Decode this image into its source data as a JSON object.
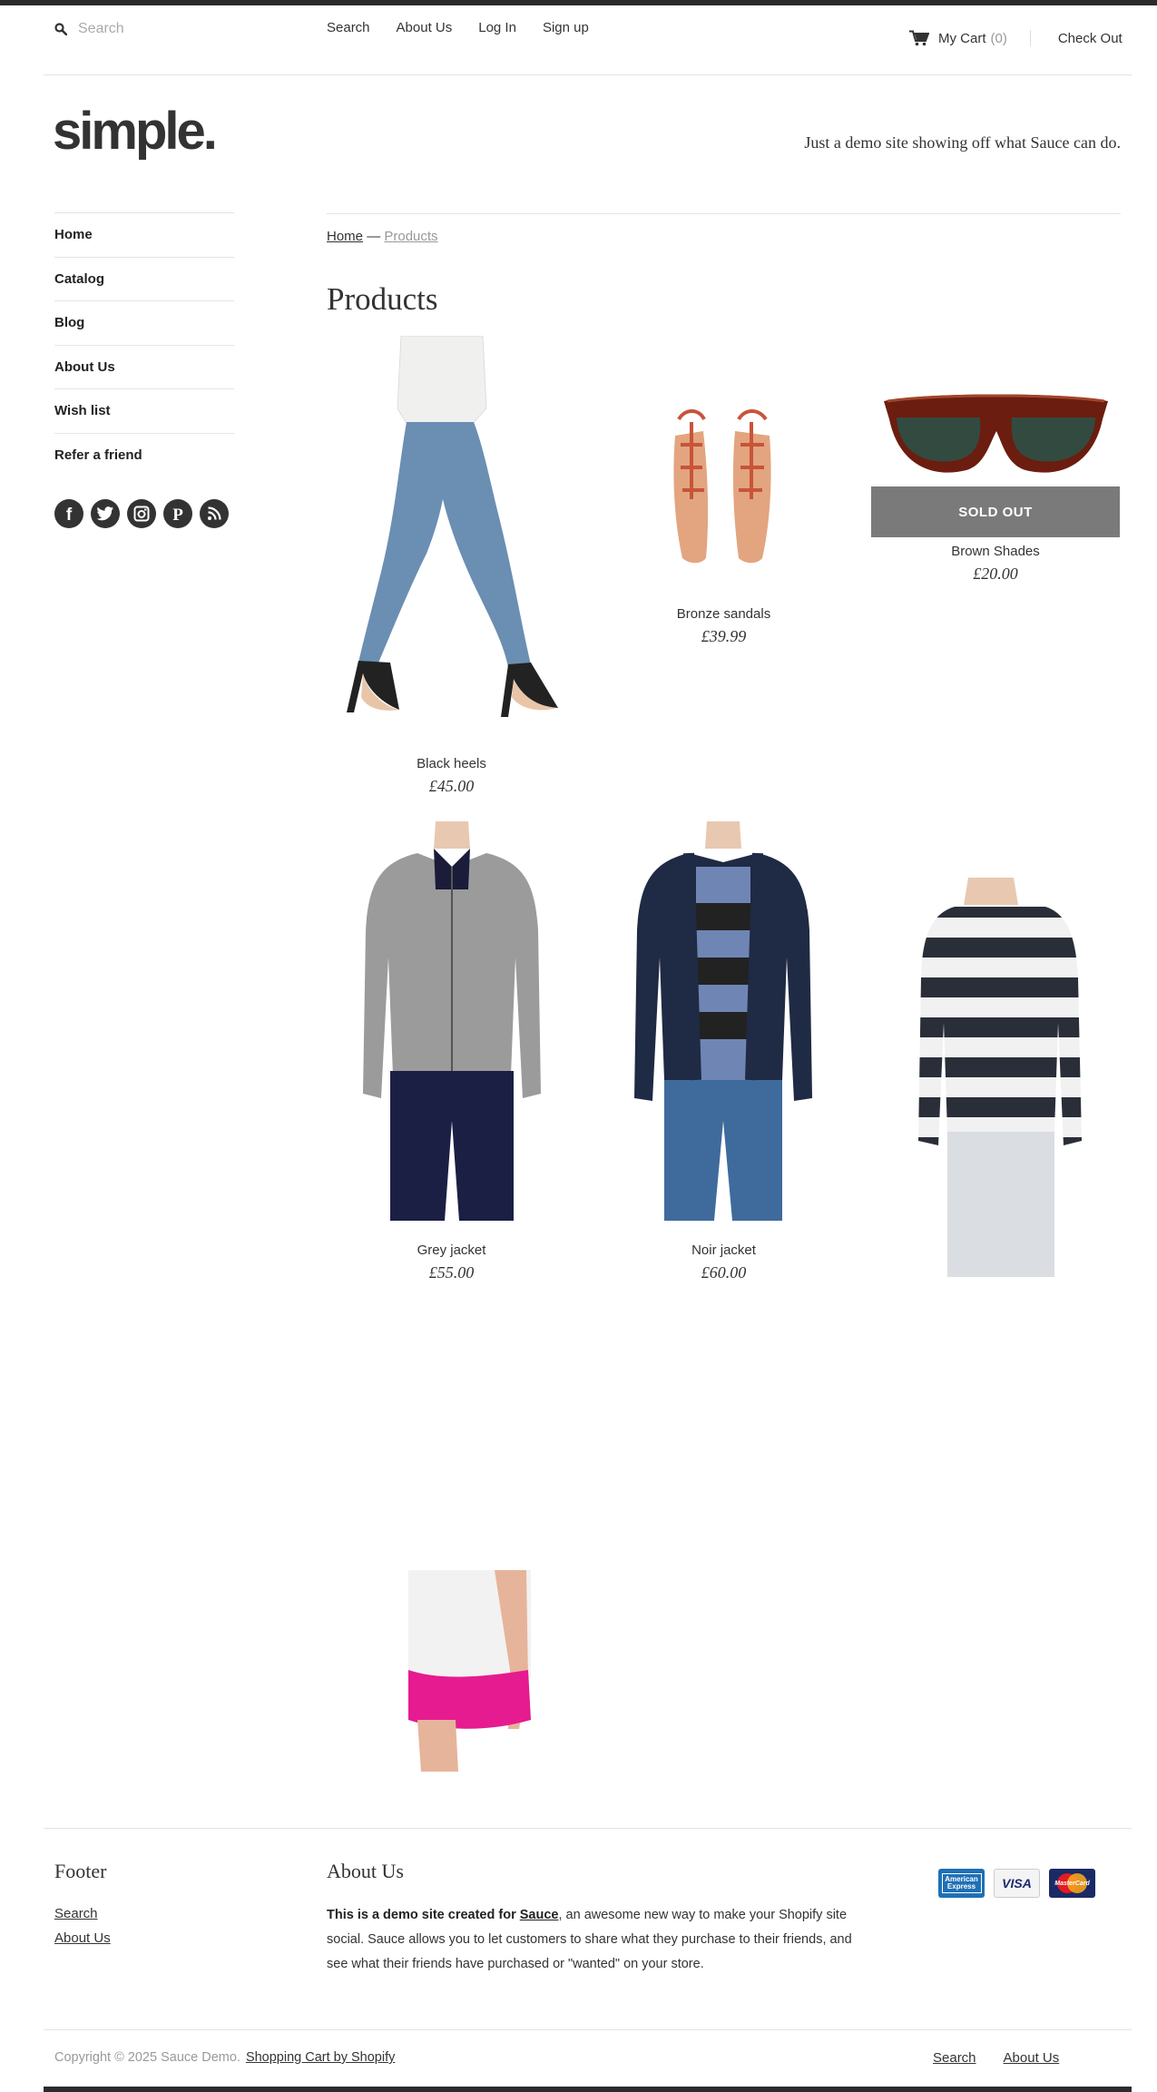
{
  "header": {
    "search_placeholder": "Search",
    "nav": [
      "Search",
      "About Us",
      "Log In",
      "Sign up"
    ],
    "cart_label": "My Cart",
    "cart_count": "(0)",
    "checkout_label": "Check Out"
  },
  "brand": {
    "logo": "simple.",
    "tagline": "Just a demo site showing off what Sauce can do."
  },
  "sidebar": {
    "items": [
      "Home",
      "Catalog",
      "Blog",
      "About Us",
      "Wish list",
      "Refer a friend"
    ],
    "social_icons": [
      "facebook-icon",
      "twitter-icon",
      "instagram-icon",
      "pinterest-icon",
      "rss-icon"
    ]
  },
  "breadcrumb": {
    "home": "Home",
    "separator": "—",
    "current": "Products"
  },
  "page_title": "Products",
  "products": [
    {
      "name": "Black heels",
      "price": "£45.00",
      "sold_out": false
    },
    {
      "name": "Bronze sandals",
      "price": "£39.99",
      "sold_out": false
    },
    {
      "name": "Brown Shades",
      "price": "£20.00",
      "sold_out": true,
      "badge": "SOLD OUT"
    },
    {
      "name": "Grey jacket",
      "price": "£55.00",
      "sold_out": false
    },
    {
      "name": "Noir jacket",
      "price": "£60.00",
      "sold_out": false
    }
  ],
  "footer": {
    "col1_title": "Footer",
    "col1_links": [
      "Search",
      "About Us"
    ],
    "about_title": "About Us",
    "about_bold": "This is a demo site created for",
    "about_link": "Sauce",
    "about_rest": ", an awesome new way to make your Shopify site social. Sauce allows you to let customers to share what they purchase to their friends, and see what their friends have purchased or \"wanted\" on your store.",
    "cards": [
      "American Express",
      "VISA",
      "MasterCard"
    ],
    "copyright": "Copyright © 2025 Sauce Demo.",
    "copyright_link": "Shopping Cart by Shopify",
    "bottom_nav": [
      "Search",
      "About Us"
    ]
  },
  "colors": {
    "text": "#333333",
    "muted": "#999999",
    "soldout_bg": "#7a7a7a",
    "bar": "#2b2b2b"
  }
}
